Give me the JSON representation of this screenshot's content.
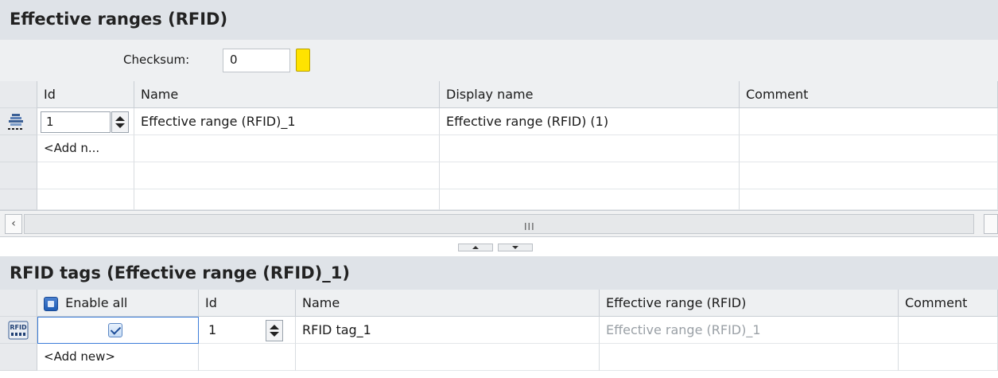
{
  "top_section": {
    "title": "Effective ranges (RFID)",
    "checksum_label": "Checksum:",
    "checksum_value": "0",
    "checksum_color": "#ffe300",
    "columns": [
      "Id",
      "Name",
      "Display name",
      "Comment"
    ],
    "rows": [
      {
        "icon": "effective-range-icon",
        "id": "1",
        "name": "Effective range (RFID)_1",
        "display_name": "Effective range (RFID) (1)",
        "comment": ""
      }
    ],
    "add_row_label": "<Add n..."
  },
  "bottom_section": {
    "title": "RFID tags (Effective range (RFID)_1)",
    "columns": {
      "enable_all": "Enable all",
      "id": "Id",
      "name": "Name",
      "range": "Effective range (RFID)",
      "comment": "Comment"
    },
    "rows": [
      {
        "icon": "rfid-tag-icon",
        "enabled": true,
        "id": "1",
        "name": "RFID tag_1",
        "range": "Effective range (RFID)_1",
        "comment": ""
      }
    ],
    "add_row_label": "<Add new>"
  },
  "scrollbar": {
    "left_arrow": "‹",
    "grip": "III"
  }
}
